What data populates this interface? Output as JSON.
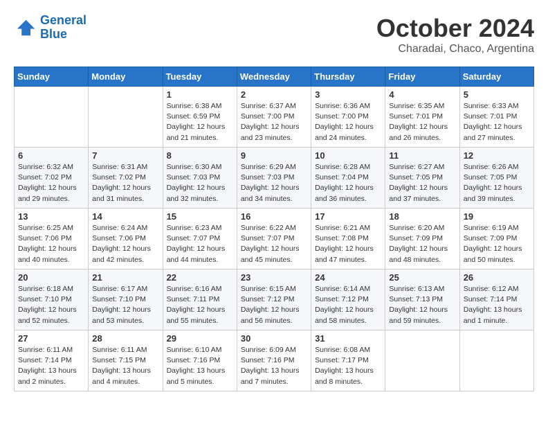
{
  "logo": {
    "line1": "General",
    "line2": "Blue"
  },
  "title": "October 2024",
  "subtitle": "Charadai, Chaco, Argentina",
  "days_header": [
    "Sunday",
    "Monday",
    "Tuesday",
    "Wednesday",
    "Thursday",
    "Friday",
    "Saturday"
  ],
  "weeks": [
    [
      {
        "day": "",
        "sunrise": "",
        "sunset": "",
        "daylight": ""
      },
      {
        "day": "",
        "sunrise": "",
        "sunset": "",
        "daylight": ""
      },
      {
        "day": "1",
        "sunrise": "Sunrise: 6:38 AM",
        "sunset": "Sunset: 6:59 PM",
        "daylight": "Daylight: 12 hours and 21 minutes."
      },
      {
        "day": "2",
        "sunrise": "Sunrise: 6:37 AM",
        "sunset": "Sunset: 7:00 PM",
        "daylight": "Daylight: 12 hours and 23 minutes."
      },
      {
        "day": "3",
        "sunrise": "Sunrise: 6:36 AM",
        "sunset": "Sunset: 7:00 PM",
        "daylight": "Daylight: 12 hours and 24 minutes."
      },
      {
        "day": "4",
        "sunrise": "Sunrise: 6:35 AM",
        "sunset": "Sunset: 7:01 PM",
        "daylight": "Daylight: 12 hours and 26 minutes."
      },
      {
        "day": "5",
        "sunrise": "Sunrise: 6:33 AM",
        "sunset": "Sunset: 7:01 PM",
        "daylight": "Daylight: 12 hours and 27 minutes."
      }
    ],
    [
      {
        "day": "6",
        "sunrise": "Sunrise: 6:32 AM",
        "sunset": "Sunset: 7:02 PM",
        "daylight": "Daylight: 12 hours and 29 minutes."
      },
      {
        "day": "7",
        "sunrise": "Sunrise: 6:31 AM",
        "sunset": "Sunset: 7:02 PM",
        "daylight": "Daylight: 12 hours and 31 minutes."
      },
      {
        "day": "8",
        "sunrise": "Sunrise: 6:30 AM",
        "sunset": "Sunset: 7:03 PM",
        "daylight": "Daylight: 12 hours and 32 minutes."
      },
      {
        "day": "9",
        "sunrise": "Sunrise: 6:29 AM",
        "sunset": "Sunset: 7:03 PM",
        "daylight": "Daylight: 12 hours and 34 minutes."
      },
      {
        "day": "10",
        "sunrise": "Sunrise: 6:28 AM",
        "sunset": "Sunset: 7:04 PM",
        "daylight": "Daylight: 12 hours and 36 minutes."
      },
      {
        "day": "11",
        "sunrise": "Sunrise: 6:27 AM",
        "sunset": "Sunset: 7:05 PM",
        "daylight": "Daylight: 12 hours and 37 minutes."
      },
      {
        "day": "12",
        "sunrise": "Sunrise: 6:26 AM",
        "sunset": "Sunset: 7:05 PM",
        "daylight": "Daylight: 12 hours and 39 minutes."
      }
    ],
    [
      {
        "day": "13",
        "sunrise": "Sunrise: 6:25 AM",
        "sunset": "Sunset: 7:06 PM",
        "daylight": "Daylight: 12 hours and 40 minutes."
      },
      {
        "day": "14",
        "sunrise": "Sunrise: 6:24 AM",
        "sunset": "Sunset: 7:06 PM",
        "daylight": "Daylight: 12 hours and 42 minutes."
      },
      {
        "day": "15",
        "sunrise": "Sunrise: 6:23 AM",
        "sunset": "Sunset: 7:07 PM",
        "daylight": "Daylight: 12 hours and 44 minutes."
      },
      {
        "day": "16",
        "sunrise": "Sunrise: 6:22 AM",
        "sunset": "Sunset: 7:07 PM",
        "daylight": "Daylight: 12 hours and 45 minutes."
      },
      {
        "day": "17",
        "sunrise": "Sunrise: 6:21 AM",
        "sunset": "Sunset: 7:08 PM",
        "daylight": "Daylight: 12 hours and 47 minutes."
      },
      {
        "day": "18",
        "sunrise": "Sunrise: 6:20 AM",
        "sunset": "Sunset: 7:09 PM",
        "daylight": "Daylight: 12 hours and 48 minutes."
      },
      {
        "day": "19",
        "sunrise": "Sunrise: 6:19 AM",
        "sunset": "Sunset: 7:09 PM",
        "daylight": "Daylight: 12 hours and 50 minutes."
      }
    ],
    [
      {
        "day": "20",
        "sunrise": "Sunrise: 6:18 AM",
        "sunset": "Sunset: 7:10 PM",
        "daylight": "Daylight: 12 hours and 52 minutes."
      },
      {
        "day": "21",
        "sunrise": "Sunrise: 6:17 AM",
        "sunset": "Sunset: 7:10 PM",
        "daylight": "Daylight: 12 hours and 53 minutes."
      },
      {
        "day": "22",
        "sunrise": "Sunrise: 6:16 AM",
        "sunset": "Sunset: 7:11 PM",
        "daylight": "Daylight: 12 hours and 55 minutes."
      },
      {
        "day": "23",
        "sunrise": "Sunrise: 6:15 AM",
        "sunset": "Sunset: 7:12 PM",
        "daylight": "Daylight: 12 hours and 56 minutes."
      },
      {
        "day": "24",
        "sunrise": "Sunrise: 6:14 AM",
        "sunset": "Sunset: 7:12 PM",
        "daylight": "Daylight: 12 hours and 58 minutes."
      },
      {
        "day": "25",
        "sunrise": "Sunrise: 6:13 AM",
        "sunset": "Sunset: 7:13 PM",
        "daylight": "Daylight: 12 hours and 59 minutes."
      },
      {
        "day": "26",
        "sunrise": "Sunrise: 6:12 AM",
        "sunset": "Sunset: 7:14 PM",
        "daylight": "Daylight: 13 hours and 1 minute."
      }
    ],
    [
      {
        "day": "27",
        "sunrise": "Sunrise: 6:11 AM",
        "sunset": "Sunset: 7:14 PM",
        "daylight": "Daylight: 13 hours and 2 minutes."
      },
      {
        "day": "28",
        "sunrise": "Sunrise: 6:11 AM",
        "sunset": "Sunset: 7:15 PM",
        "daylight": "Daylight: 13 hours and 4 minutes."
      },
      {
        "day": "29",
        "sunrise": "Sunrise: 6:10 AM",
        "sunset": "Sunset: 7:16 PM",
        "daylight": "Daylight: 13 hours and 5 minutes."
      },
      {
        "day": "30",
        "sunrise": "Sunrise: 6:09 AM",
        "sunset": "Sunset: 7:16 PM",
        "daylight": "Daylight: 13 hours and 7 minutes."
      },
      {
        "day": "31",
        "sunrise": "Sunrise: 6:08 AM",
        "sunset": "Sunset: 7:17 PM",
        "daylight": "Daylight: 13 hours and 8 minutes."
      },
      {
        "day": "",
        "sunrise": "",
        "sunset": "",
        "daylight": ""
      },
      {
        "day": "",
        "sunrise": "",
        "sunset": "",
        "daylight": ""
      }
    ]
  ]
}
